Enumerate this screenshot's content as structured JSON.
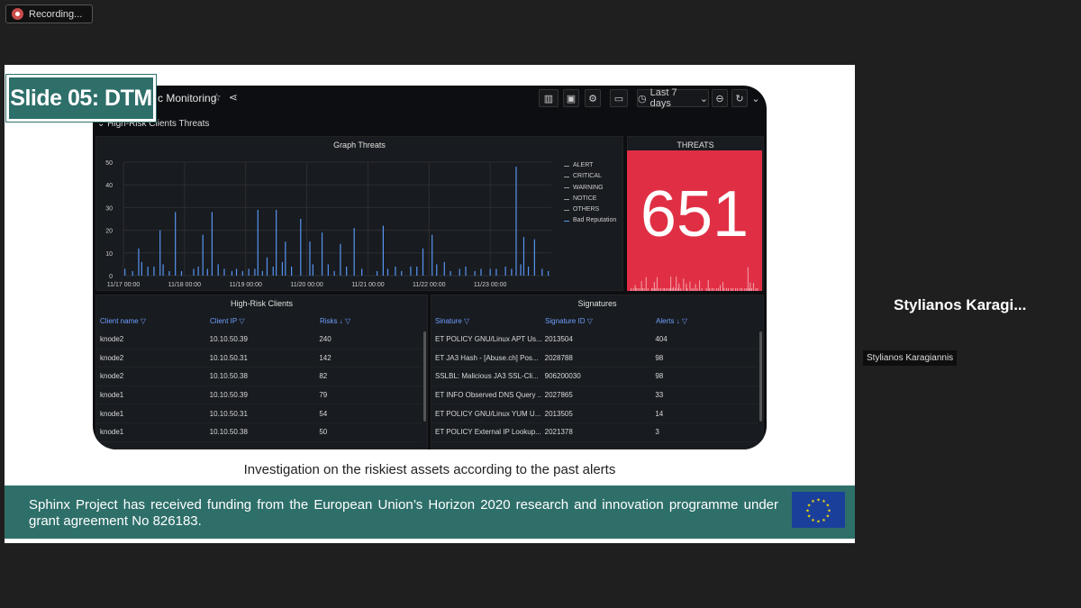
{
  "recording": {
    "label": "Recording..."
  },
  "slide": {
    "tag": "Slide 05: DTM",
    "caption": "Investigation on the riskiest assets according to the past alerts",
    "footer": "Sphinx Project has received funding from the European Union’s Horizon 2020 research and innovation programme under grant agreement No 826183."
  },
  "dashboard": {
    "title": "c Monitoring",
    "time_range": "Last 7 days",
    "row_title": "High-Risk Clients Threats",
    "graph_title": "Graph Threats",
    "legend": [
      "ALERT",
      "CRITICAL",
      "WARNING",
      "NOTICE",
      "OTHERS",
      "Bad Reputation"
    ],
    "legend_colors": [
      "#999999",
      "#999999",
      "#999999",
      "#999999",
      "#999999",
      "#5794f2"
    ],
    "threats_title": "THREATS",
    "threats_value": "651"
  },
  "chart_data": {
    "type": "bar",
    "y_ticks": [
      "50",
      "40",
      "30",
      "20",
      "10",
      "0"
    ],
    "ylim": [
      0,
      50
    ],
    "x_ticks": [
      "11/17 00:00",
      "11/18 00:00",
      "11/19 00:00",
      "11/20 00:00",
      "11/21 00:00",
      "11/22 00:00",
      "11/23 00:00"
    ],
    "series": [
      {
        "name": "Bad Reputation",
        "points": [
          [
            0.05,
            3
          ],
          [
            0.3,
            2
          ],
          [
            0.5,
            12
          ],
          [
            0.6,
            6
          ],
          [
            0.8,
            4
          ],
          [
            1.0,
            4
          ],
          [
            1.2,
            20
          ],
          [
            1.3,
            5
          ],
          [
            1.5,
            2
          ],
          [
            1.7,
            28
          ],
          [
            1.9,
            2
          ],
          [
            2.3,
            3
          ],
          [
            2.45,
            4
          ],
          [
            2.6,
            18
          ],
          [
            2.75,
            3
          ],
          [
            2.9,
            28
          ],
          [
            3.1,
            5
          ],
          [
            3.3,
            3
          ],
          [
            3.55,
            2
          ],
          [
            3.7,
            3
          ],
          [
            3.9,
            2
          ],
          [
            4.1,
            3
          ],
          [
            4.3,
            3
          ],
          [
            4.4,
            29
          ],
          [
            4.55,
            2
          ],
          [
            4.7,
            8
          ],
          [
            4.9,
            4
          ],
          [
            5.0,
            29
          ],
          [
            5.2,
            6
          ],
          [
            5.3,
            15
          ],
          [
            5.5,
            4
          ],
          [
            5.8,
            25
          ],
          [
            6.1,
            15
          ],
          [
            6.2,
            5
          ],
          [
            6.5,
            19
          ],
          [
            6.7,
            5
          ],
          [
            6.9,
            2
          ],
          [
            7.1,
            14
          ],
          [
            7.3,
            4
          ],
          [
            7.55,
            21
          ],
          [
            7.8,
            3
          ],
          [
            8.3,
            2
          ],
          [
            8.5,
            22
          ],
          [
            8.65,
            3
          ],
          [
            8.9,
            4
          ],
          [
            9.1,
            2
          ],
          [
            9.4,
            4
          ],
          [
            9.6,
            4
          ],
          [
            9.8,
            12
          ],
          [
            10.1,
            18
          ],
          [
            10.25,
            5
          ],
          [
            10.5,
            6
          ],
          [
            10.7,
            2
          ],
          [
            11.0,
            3
          ],
          [
            11.2,
            4
          ],
          [
            11.5,
            2
          ],
          [
            11.7,
            3
          ],
          [
            12.0,
            3
          ],
          [
            12.2,
            3
          ],
          [
            12.5,
            4
          ],
          [
            12.7,
            3
          ],
          [
            12.85,
            48
          ],
          [
            13.0,
            5
          ],
          [
            13.1,
            17
          ],
          [
            13.25,
            4
          ],
          [
            13.45,
            16
          ],
          [
            13.7,
            3
          ],
          [
            13.9,
            2
          ]
        ]
      }
    ]
  },
  "clients": {
    "title": "High-Risk Clients",
    "headers": [
      "Client name",
      "Client IP",
      "Risks"
    ],
    "rows": [
      [
        "knode2",
        "10.10.50.39",
        "240"
      ],
      [
        "knode2",
        "10.10.50.31",
        "142"
      ],
      [
        "knode2",
        "10.10.50.38",
        "82"
      ],
      [
        "knode1",
        "10.10.50.39",
        "79"
      ],
      [
        "knode1",
        "10.10.50.31",
        "54"
      ],
      [
        "knode1",
        "10.10.50.38",
        "50"
      ]
    ]
  },
  "signatures": {
    "title": "Signatures",
    "headers": [
      "Sinature",
      "Signature ID",
      "Alerts"
    ],
    "rows": [
      [
        "ET POLICY GNU/Linux APT Us...",
        "2013504",
        "404"
      ],
      [
        "ET JA3 Hash - [Abuse.ch] Pos...",
        "2028788",
        "98"
      ],
      [
        "SSLBL: Malicious JA3 SSL-Cli...",
        "906200030",
        "98"
      ],
      [
        "ET INFO Observed DNS Query ...",
        "2027865",
        "33"
      ],
      [
        "ET POLICY GNU/Linux YUM U...",
        "2013505",
        "14"
      ],
      [
        "ET POLICY External IP Lookup...",
        "2021378",
        "3"
      ]
    ]
  },
  "participant": {
    "display_name": "Stylianos  Karagi...",
    "name_label": "Stylianos Karagiannis"
  },
  "colors": {
    "teal": "#2e6f6a",
    "threat_red": "#e02f44",
    "series_blue": "#5794f2"
  }
}
